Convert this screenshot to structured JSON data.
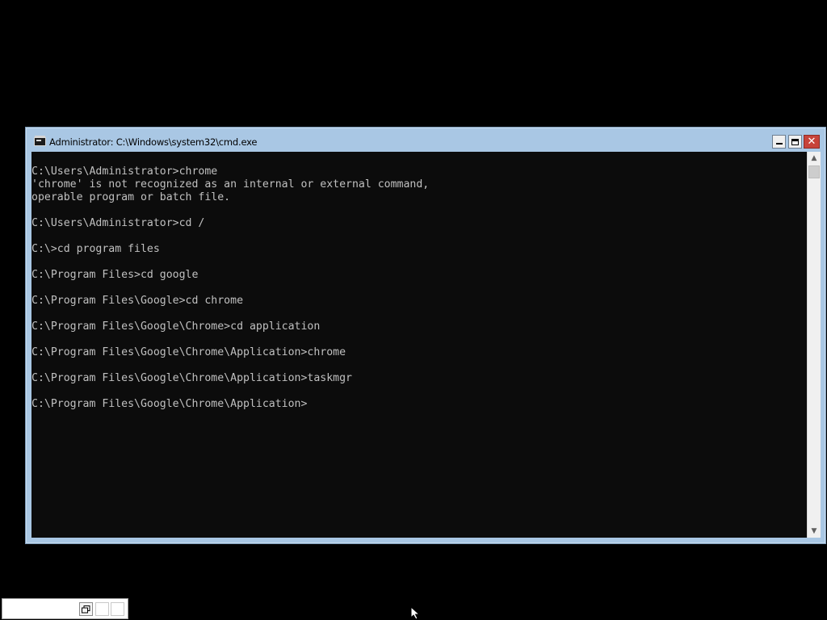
{
  "window": {
    "title": "Administrator: C:\\Windows\\system32\\cmd.exe",
    "controls": {
      "minimize_icon": "minimize-icon",
      "maximize_icon": "maximize-icon",
      "close_glyph": "✕"
    },
    "frame_color": "#a9c7e4",
    "close_color": "#c7433a"
  },
  "console": {
    "background": "#0c0c0c",
    "foreground": "#c0c0c0",
    "lines": [
      "C:\\Users\\Administrator>chrome",
      "'chrome' is not recognized as an internal or external command,",
      "operable program or batch file.",
      "",
      "C:\\Users\\Administrator>cd /",
      "",
      "C:\\>cd program files",
      "",
      "C:\\Program Files>cd google",
      "",
      "C:\\Program Files\\Google>cd chrome",
      "",
      "C:\\Program Files\\Google\\Chrome>cd application",
      "",
      "C:\\Program Files\\Google\\Chrome\\Application>chrome",
      "",
      "C:\\Program Files\\Google\\Chrome\\Application>taskmgr",
      "",
      "C:\\Program Files\\Google\\Chrome\\Application>"
    ]
  },
  "scrollbar": {
    "up_arrow": "▲",
    "down_arrow": "▼"
  },
  "minimized_window": {
    "restore_glyph": "🗗"
  },
  "icons": {
    "app": "console-app-icon",
    "cursor": "mouse-pointer-icon"
  }
}
